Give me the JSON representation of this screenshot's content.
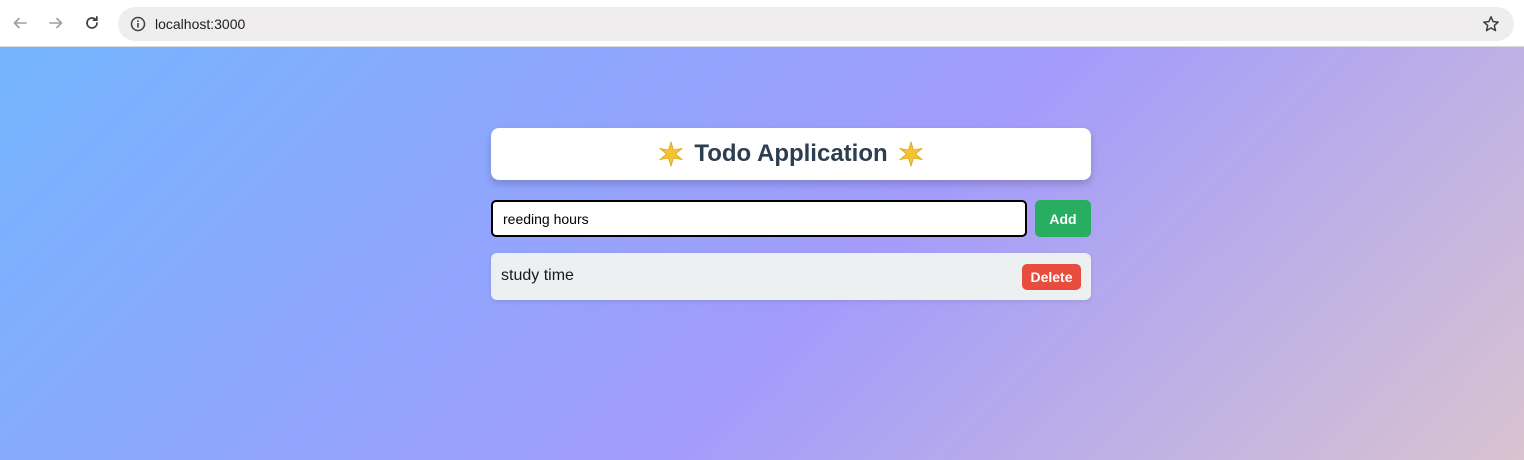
{
  "browser": {
    "url": "localhost:3000",
    "icons": {
      "back": "arrow-left-icon",
      "forward": "arrow-right-icon",
      "reload": "reload-icon",
      "site_info": "info-icon",
      "bookmark": "star-icon"
    }
  },
  "app": {
    "title": "Todo Application",
    "title_icon": "sparkle-star-icon",
    "input": {
      "value": "reeding hours",
      "placeholder": ""
    },
    "add_label": "Add",
    "todos": [
      {
        "text": "study time",
        "delete_label": "Delete"
      }
    ]
  },
  "colors": {
    "title_text": "#2c3e50",
    "add_button": "#27ae60",
    "delete_button": "#e74c3c",
    "item_background": "#ecf0f1",
    "gradient_start": "#74b5fe",
    "gradient_mid": "#a29bfc",
    "gradient_end": "#d9c3d0"
  }
}
